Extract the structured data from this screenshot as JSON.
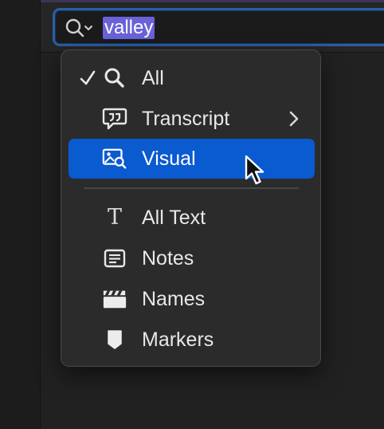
{
  "search": {
    "query": "valley",
    "scope_icon": "magnifier-with-dropdown-icon"
  },
  "menu": {
    "items": [
      {
        "label": "All",
        "icon": "search-icon",
        "checked": true
      },
      {
        "label": "Transcript",
        "icon": "speech-bubble-quote-icon",
        "submenu": true
      },
      {
        "label": "Visual",
        "icon": "image-search-icon",
        "selected": true
      },
      {
        "label": "All Text",
        "icon": "text-T-icon"
      },
      {
        "label": "Notes",
        "icon": "notes-icon"
      },
      {
        "label": "Names",
        "icon": "clapperboard-icon"
      },
      {
        "label": "Markers",
        "icon": "marker-icon"
      }
    ]
  },
  "colors": {
    "highlight": "#0a5ad0",
    "text_selection": "#6a62d8",
    "focus_ring": "#2b5ea3"
  }
}
